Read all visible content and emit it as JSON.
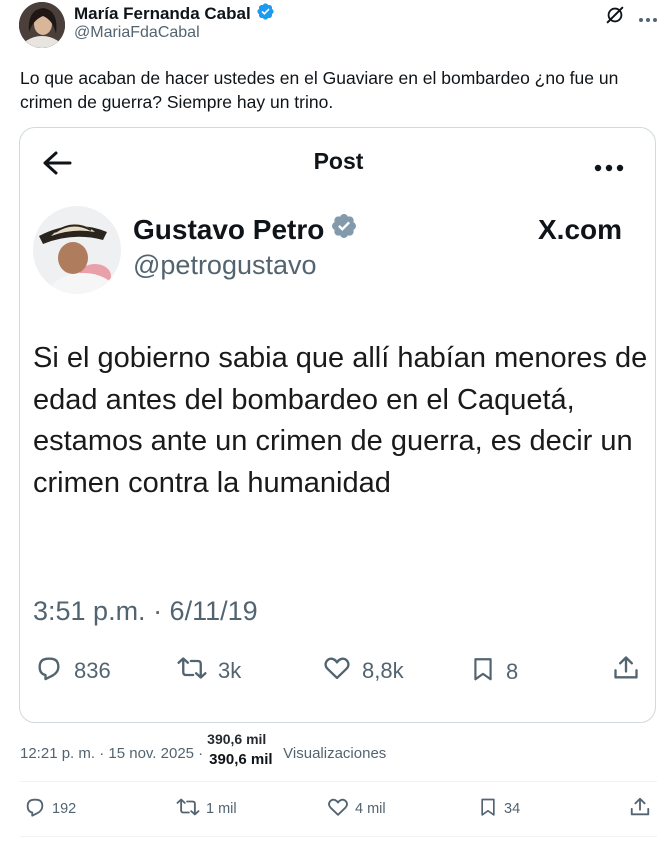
{
  "author": {
    "name": "María Fernanda Cabal",
    "handle": "@MariaFdaCabal"
  },
  "tweet": {
    "text": "Lo que acaban de hacer ustedes en el Guaviare en el bombardeo ¿no fue un crimen de guerra? Siempre hay un trino."
  },
  "quoted_screenshot": {
    "header_title": "Post",
    "name": "Gustavo Petro",
    "handle": "@petrogustavo",
    "watermark": "X.com",
    "text": "Si el gobierno sabia que allí habían menores de edad antes del bombardeo en el Caquetá, estamos ante un crimen de guerra, es decir un crimen contra la humanidad",
    "timestamp": "3:51 p.m. · 6/11/19",
    "actions": {
      "replies": "836",
      "reposts": "3k",
      "likes": "8,8k",
      "bookmarks": "8"
    }
  },
  "meta": {
    "time": "12:21 p. m. · 15 nov. 2025 ·",
    "views_overlap": "390,6 mil",
    "views_count": "390,6 mil",
    "views_label": "Visualizaciones"
  },
  "actions": {
    "replies": "192",
    "reposts": "1 mil",
    "likes": "4 mil",
    "bookmarks": "34"
  },
  "colors": {
    "verified_blue": "#1d9bf0",
    "verified_gray": "#829aab",
    "text_secondary": "#536471",
    "border": "#cfd9de"
  }
}
